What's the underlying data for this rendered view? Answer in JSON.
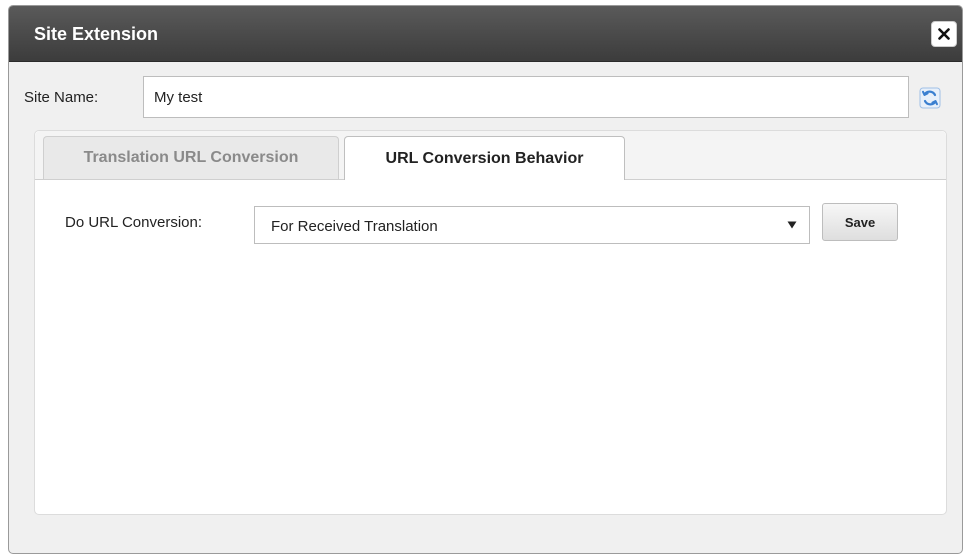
{
  "dialog": {
    "title": "Site Extension",
    "close_icon": "close-icon"
  },
  "site": {
    "label": "Site Name:",
    "value": "My test",
    "refresh_icon": "refresh-icon"
  },
  "tabs": [
    {
      "label": "Translation URL Conversion",
      "active": false
    },
    {
      "label": "URL Conversion Behavior",
      "active": true
    }
  ],
  "conversion": {
    "label": "Do URL Conversion:",
    "selected": "For Received Translation",
    "dropdown_icon": "chevron-down-icon"
  },
  "actions": {
    "save_label": "Save"
  },
  "colors": {
    "titlebar": "#4a4a4a",
    "refresh_icon": "#3a7fd0"
  }
}
